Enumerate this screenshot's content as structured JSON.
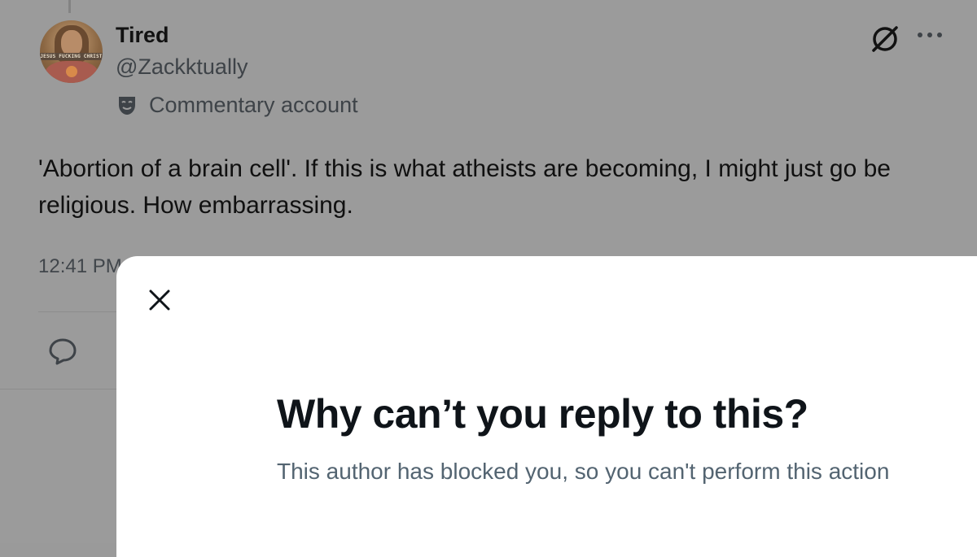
{
  "tweet": {
    "author_name": "Tired",
    "handle": "@Zackktually",
    "label": "Commentary account",
    "avatar_banner_text": "JESUS FUCKING CHRIST",
    "text": "'Abortion of a brain cell'. If this is what atheists are becoming, I might just go be religious. How embarrassing.",
    "timestamp": "12:41 PM"
  },
  "icons": {
    "label_icon": "theater-mask-icon",
    "grok": "grok-icon",
    "more": "more-dots-icon",
    "reply": "reply-icon",
    "close": "close-icon"
  },
  "modal": {
    "title": "Why can’t you reply to this?",
    "body": "This author has blocked you, so you can't perform this action"
  },
  "colors": {
    "overlay_bg": "#9b9b9b",
    "modal_bg": "#ffffff",
    "title": "#0f1419",
    "body": "#536471"
  }
}
